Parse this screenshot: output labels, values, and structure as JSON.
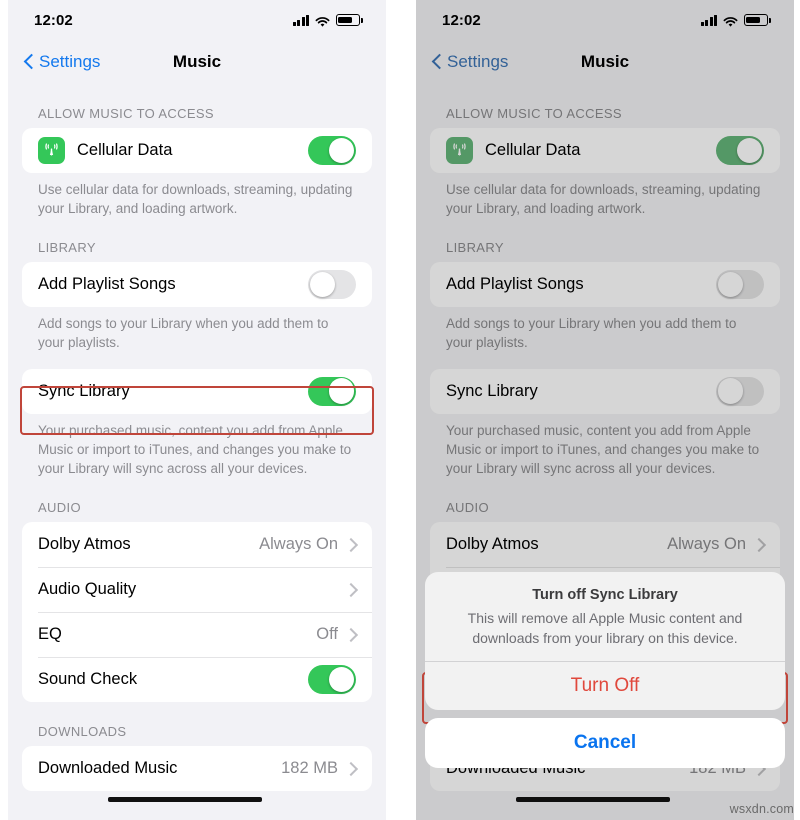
{
  "status_bar": {
    "time": "12:02",
    "cellular_icon": "cellular-bars-icon",
    "wifi_icon": "wifi-icon",
    "battery_icon": "battery-icon"
  },
  "nav": {
    "back_label": "Settings",
    "title": "Music",
    "back_icon": "chevron-left-icon"
  },
  "sections": {
    "allow_access": {
      "header": "ALLOW MUSIC TO ACCESS",
      "cellular_data": {
        "label": "Cellular Data",
        "icon": "cellular-antenna-icon",
        "icon_color": "#34c759",
        "toggle_on": true
      },
      "footnote": "Use cellular data for downloads, streaming, updating your Library, and loading artwork."
    },
    "library": {
      "header": "LIBRARY",
      "add_playlist_songs": {
        "label": "Add Playlist Songs",
        "toggle_on": false
      },
      "add_playlist_footnote": "Add songs to your Library when you add them to your playlists.",
      "sync_library": {
        "label": "Sync Library",
        "toggle_on_left": true,
        "toggle_on_right": false
      },
      "sync_footnote": "Your purchased music, content you add from Apple Music or import to iTunes, and changes you make to your Library will sync across all your devices."
    },
    "audio": {
      "header": "AUDIO",
      "rows": [
        {
          "label": "Dolby Atmos",
          "value": "Always On",
          "kind": "chevron"
        },
        {
          "label": "Audio Quality",
          "value": "",
          "kind": "chevron"
        },
        {
          "label": "EQ",
          "value": "Off",
          "kind": "chevron"
        },
        {
          "label": "Sound Check",
          "value": "",
          "kind": "toggle",
          "toggle_on": true
        }
      ]
    },
    "downloads": {
      "header": "DOWNLOADS",
      "downloaded_music": {
        "label": "Downloaded Music",
        "value": "182 MB",
        "kind": "chevron",
        "redacted": true
      }
    }
  },
  "alert": {
    "title": "Turn off Sync Library",
    "message": "This will remove all Apple Music content and downloads from your library on this device.",
    "destructive_label": "Turn Off",
    "cancel_label": "Cancel",
    "destructive_color": "#e0483c",
    "cancel_color": "#0a74ef"
  },
  "annotations": {
    "highlight_color": "#c0453a",
    "left_highlight_target": "sync-library-row",
    "right_highlight_target": "turn-off-button"
  },
  "watermark": "wsxdn.com"
}
